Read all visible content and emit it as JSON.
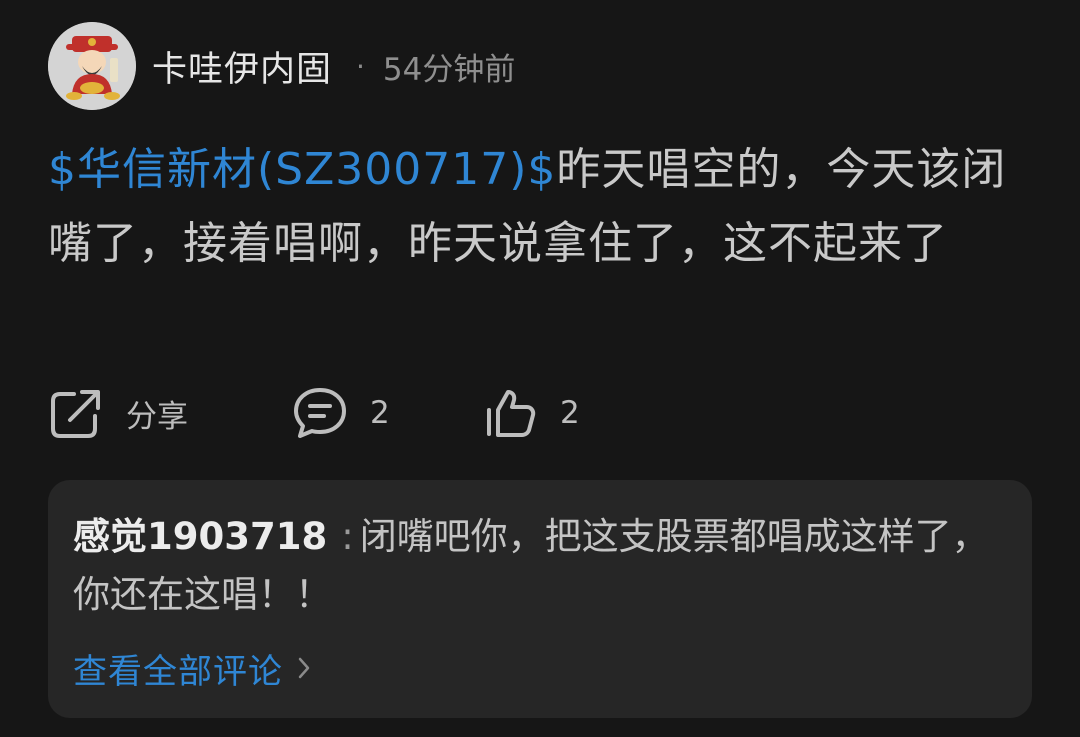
{
  "post": {
    "author": "卡哇伊内固",
    "separator": "·",
    "time": "54分钟前",
    "stock_tag": "$华信新材(SZ300717)$",
    "body": "昨天唱空的，今天该闭嘴了，接着唱啊，昨天说拿住了，这不起来了"
  },
  "actions": {
    "share_label": "分享",
    "comment_count": "2",
    "like_count": "2"
  },
  "comment": {
    "author": "感觉1903718",
    "separator": ":",
    "text": "闭嘴吧你，把这支股票都唱成这样了，你还在这唱！！",
    "view_all": "查看全部评论"
  },
  "icons": {
    "share": "share-icon",
    "comment": "comment-bubble-icon",
    "like": "thumbs-up-icon",
    "chevron": "chevron-right-icon"
  },
  "colors": {
    "background": "#161616",
    "link": "#2f86d4",
    "comment_box": "#262626"
  }
}
